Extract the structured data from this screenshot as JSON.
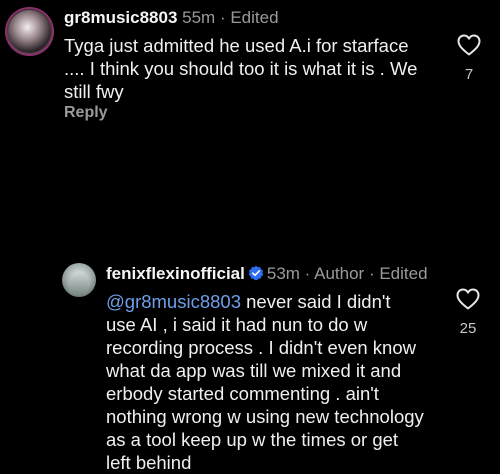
{
  "comments": [
    {
      "username": "gr8music8803",
      "time": "55m",
      "edited": "Edited",
      "text": "Tyga just admitted he used A.i for starface\n.... I think you should too it is what it is . We\nstill fwy",
      "reply_label": "Reply",
      "likes": "7"
    },
    {
      "username": "fenixflexinofficial",
      "verified": true,
      "time": "53m",
      "author_badge": "Author",
      "edited": "Edited",
      "mention": "@gr8music8803",
      "text": " never said I didn't\nuse AI , i said it had nun to do w\nrecording process . I didn't even know\nwhat da app was till we mixed it and\nerbody started commenting . ain't\nnothing wrong w using new technology\nas a tool keep up w the times or get\nleft behind",
      "likes": "25"
    }
  ],
  "colors": {
    "background": "#000000",
    "mention": "#6f9fea",
    "verified": "#2d6ff0",
    "meta": "#9a9a9a"
  },
  "icons": {
    "like": "heart-outline-icon",
    "verified": "verified-badge-icon"
  }
}
